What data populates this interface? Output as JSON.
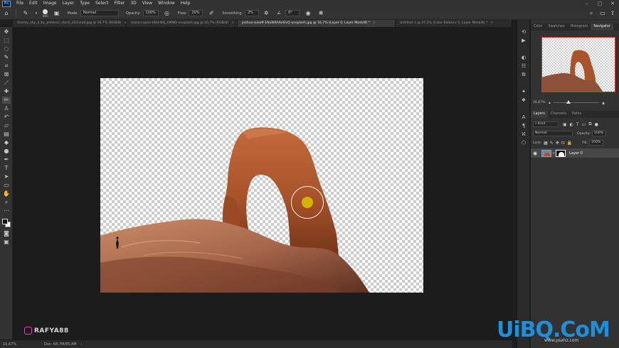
{
  "menubar": {
    "logo": "Ps",
    "items": [
      "File",
      "Edit",
      "Image",
      "Layer",
      "Type",
      "Select",
      "Filter",
      "3D",
      "View",
      "Window",
      "Help"
    ]
  },
  "optionsbar": {
    "brush_size": "800",
    "mode_label": "Mode:",
    "mode_value": "Normal",
    "opacity_label": "Opacity:",
    "opacity_value": "100%",
    "flow_label": "Flow:",
    "flow_value": "20%",
    "smoothing_label": "Smoothing:",
    "smoothing_value": "2%",
    "angle_value": "0°"
  },
  "tabs": [
    {
      "label": "stormy_sky_3_by_pelleron_stock_d22sxa6.jpg @ 16,7% (RGB/8)",
      "active": false
    },
    {
      "label": "ieana-cajina-HDd-NQ_AMNQ-unsplash.jpg @ 16,7% (RGB/8)",
      "active": false
    },
    {
      "label": "joshua-sukoff-1NoW4hAeOxQ-unsplash.jpg @ 16,7% (Layer 0, Layer Mask/8) *",
      "active": true
    },
    {
      "label": "Untitled-1 @ 37,5% (Color Balance 1, Layer Mask/8) *",
      "active": false
    }
  ],
  "statusbar": {
    "zoom": "16,67%",
    "doc": "Doc: 68,7M/85,4M"
  },
  "navigator": {
    "tabs": [
      "Color",
      "Swatches",
      "Histogram",
      "Navigator"
    ],
    "active_tab": "Navigator",
    "zoom": "16,67%"
  },
  "layers": {
    "tabs": [
      "Layers",
      "Channels",
      "Paths"
    ],
    "active_tab": "Layers",
    "filter_kind": "Kind",
    "blend_mode": "Normal",
    "opacity_label": "Opacity:",
    "opacity_value": "100%",
    "lock_label": "Lock:",
    "fill_label": "Fill:",
    "fill_value": "100%",
    "items": [
      {
        "name": "Layer 0",
        "visible": true
      }
    ]
  },
  "watermarks": {
    "instagram": "RAFYA88",
    "site": "UiBQ.CoM",
    "site_url": "www.psahz.com"
  },
  "colors": {
    "brush_cursor": "#d4b400",
    "rock": "#b55a2e",
    "accent": "#1e8fd8"
  },
  "icons": {
    "toolbar": [
      "move-icon",
      "marquee-icon",
      "lasso-icon",
      "quick-select-icon",
      "crop-icon",
      "frame-icon",
      "eyedropper-icon",
      "healing-brush-icon",
      "brush-icon",
      "clone-stamp-icon",
      "history-brush-icon",
      "eraser-icon",
      "gradient-icon",
      "blur-icon",
      "dodge-icon",
      "pen-icon",
      "type-icon",
      "path-select-icon",
      "shape-icon",
      "hand-icon",
      "zoom-icon",
      "more-tools-icon"
    ]
  }
}
